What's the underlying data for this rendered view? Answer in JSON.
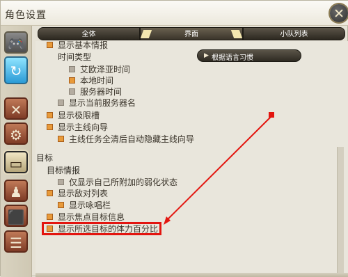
{
  "window": {
    "title": "角色设置"
  },
  "tabs": [
    {
      "label": "全体"
    },
    {
      "label": "界面"
    },
    {
      "label": "小队列表"
    }
  ],
  "top_section": {
    "cut_off_item": "显示基本情报",
    "time_type_heading": "时间类型",
    "time_options": [
      "艾欧泽亚时间",
      "本地时间",
      "服务器时间"
    ],
    "show_server_name": "显示当前服务器名",
    "show_limit_gauge": "显示极限槽",
    "show_main_guide": "显示主线向导",
    "auto_hide_guide": "主线任务全清后自动隐藏主线向导"
  },
  "language_button": {
    "label": "根据语言习惯"
  },
  "target_section": {
    "heading": "目标",
    "info_heading": "目标情报",
    "only_own_debuffs": "仅显示自己所附加的弱化状态",
    "show_enemy_list": "显示敌对列表",
    "show_cast_bar": "显示咏唱栏",
    "show_focus_info": "显示焦点目标信息",
    "show_target_hp_percent": "显示所选目标的体力百分比"
  },
  "colors": {
    "accent": "#e3150f",
    "checkbox_on": "#e89a3a",
    "checkbox_off": "#b4aca0"
  },
  "icons": [
    "gamepad-icon",
    "mouse-icon",
    "crossed-swords-icon",
    "gears-icon",
    "hud-layout-icon",
    "character-icon",
    "items-icon",
    "chat-icon",
    "close-icon"
  ]
}
